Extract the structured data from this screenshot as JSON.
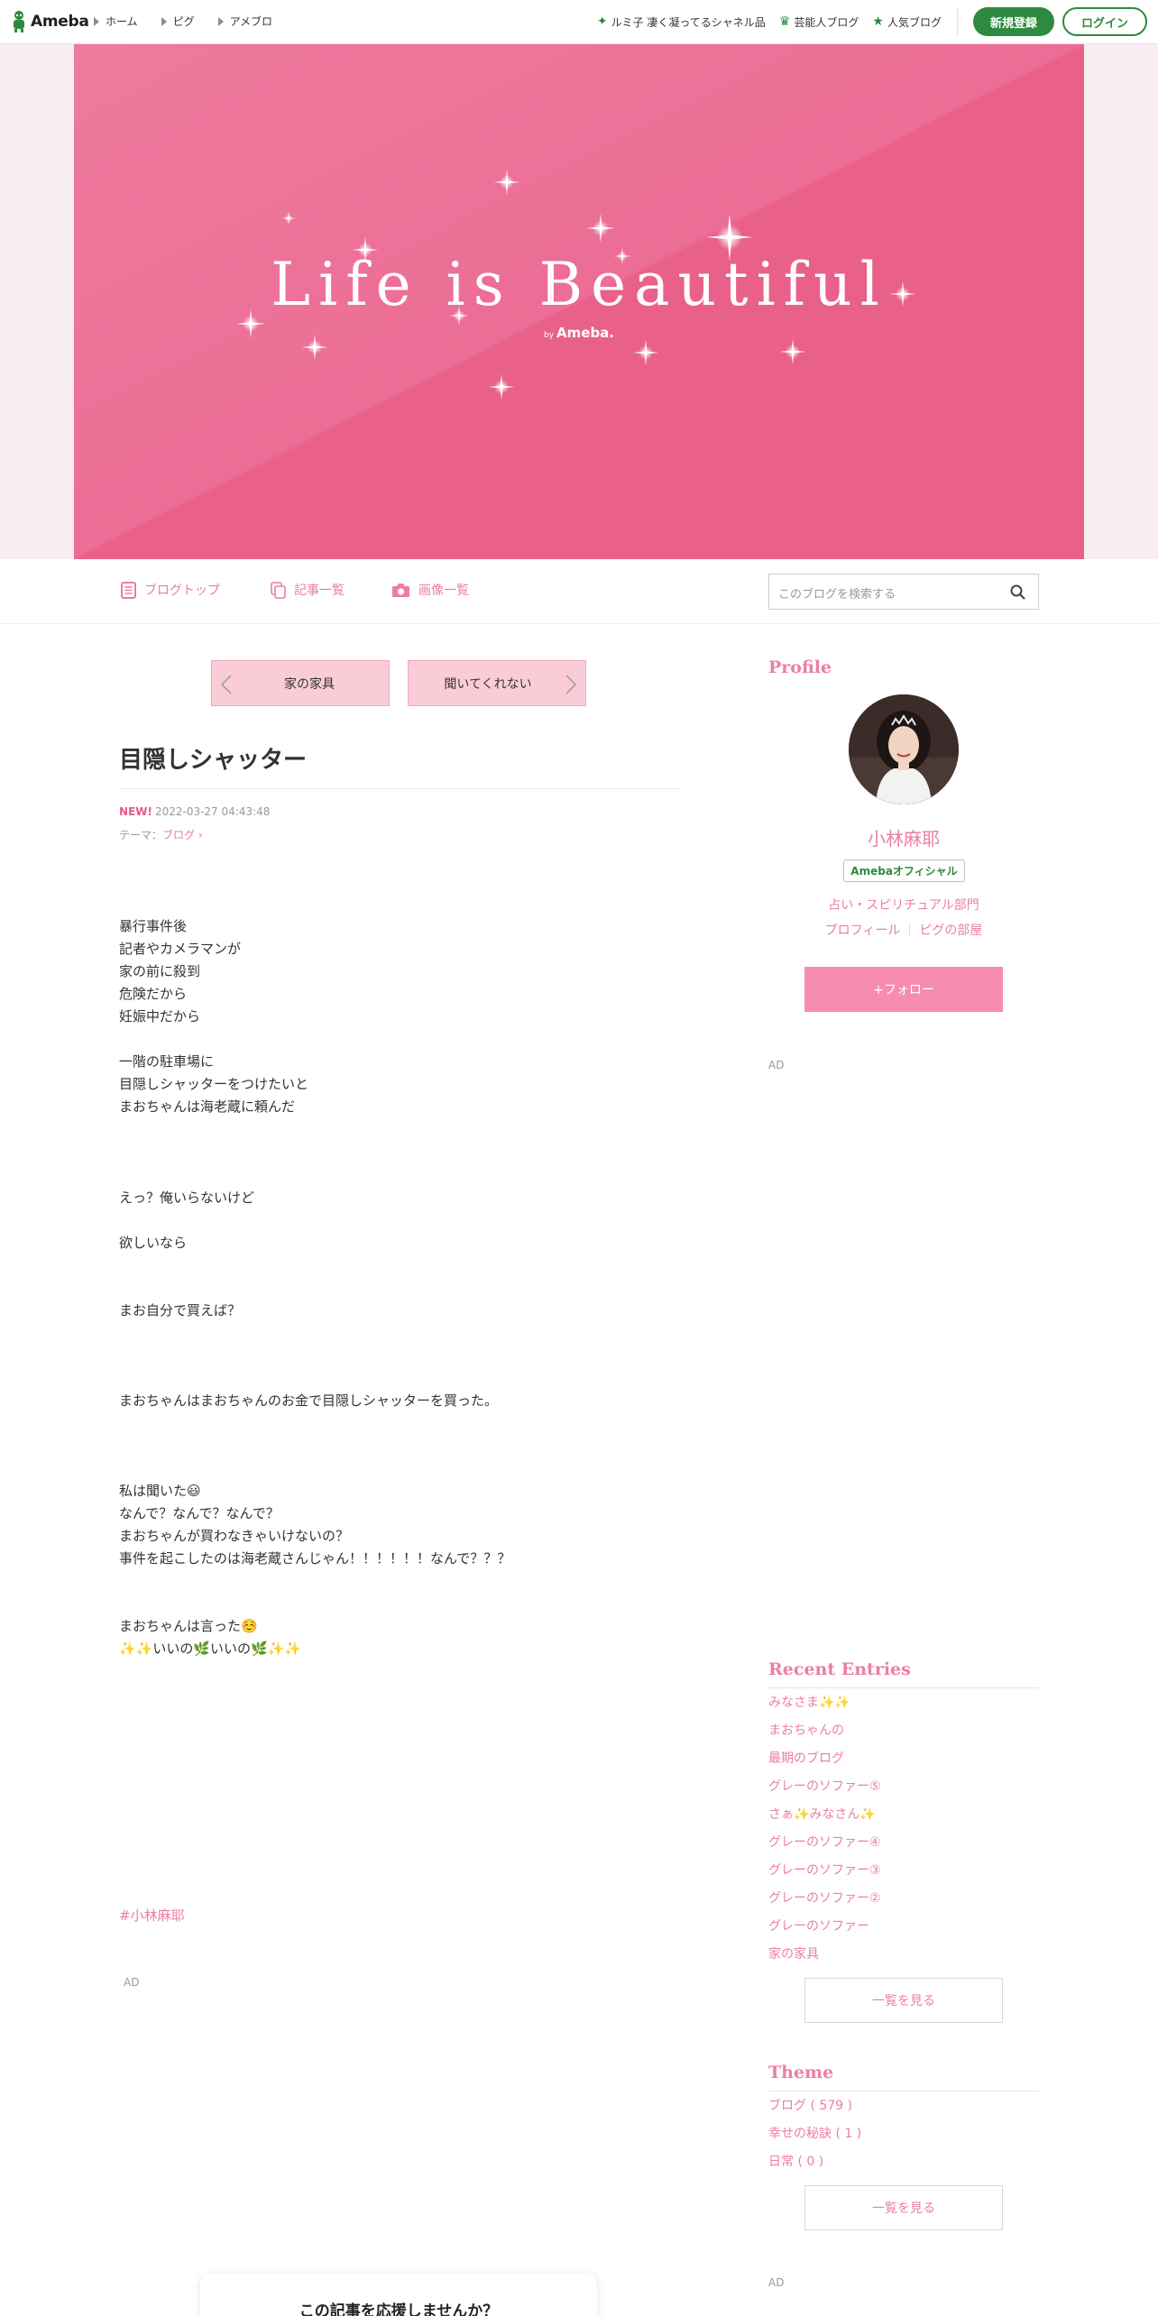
{
  "topbar": {
    "logo_text": "Ameba",
    "nav": [
      "ホーム",
      "ピグ",
      "アメブロ"
    ],
    "right_links": [
      {
        "icon": "sparkle-icon",
        "label": "ルミ子 凄く凝ってるシャネル品"
      },
      {
        "icon": "crown-icon",
        "label": "芸能人ブログ"
      },
      {
        "icon": "star-icon",
        "label": "人気ブログ"
      }
    ],
    "signup_label": "新規登録",
    "login_label": "ログイン"
  },
  "banner": {
    "title": "Life is Beautiful",
    "by": "by",
    "brand": "Ameba."
  },
  "blognav": {
    "items": [
      "ブログトップ",
      "記事一覧",
      "画像一覧"
    ],
    "search_placeholder": "このブログを検索する"
  },
  "article": {
    "prev_label": "家の家具",
    "next_label": "聞いてくれない",
    "title": "目隠しシャッター",
    "new_badge": "NEW!",
    "date": "2022-03-27 04:43:48",
    "theme_prefix": "テーマ：",
    "theme_link": "ブログ",
    "paragraphs": [
      "暴行事件後\n記者やカメラマンが\n家の前に殺到\n危険だから\n妊娠中だから",
      "一階の駐車場に\n目隠しシャッターをつけたいと\nまおちゃんは海老蔵に頼んだ",
      "えっ？俺いらないけど",
      "欲しいなら",
      "まお自分で買えば？",
      "まおちゃんはまおちゃんのお金で目隠しシャッターを買った。",
      "私は聞いた😃\nなんで？なんで？なんで？\nまおちゃんが買わなきゃいけないの？\n事件を起こしたのは海老蔵さんじゃん！！！！！！なんで？？？",
      "まおちゃんは言った☺️\n✨✨いいの🌿いいの🌿✨✨"
    ],
    "hashtag": "#小林麻耶",
    "ad_label": "AD",
    "support_text": "この記事を応援しませんか？"
  },
  "sidebar": {
    "profile_heading": "Profile",
    "name": "小林麻耶",
    "official_badge": "Amebaオフィシャル",
    "category": "占い・スピリチュアル部門",
    "profile_link": "プロフィール",
    "pigg_link": "ピグの部屋",
    "follow_label": "+フォロー",
    "ad_label": "AD",
    "recent_heading": "Recent Entries",
    "recent_entries": [
      "みなさま✨✨",
      "まおちゃんの",
      "最期のブログ",
      "グレーのソファー⑤",
      "さぁ✨みなさん✨",
      "グレーのソファー④",
      "グレーのソファー③",
      "グレーのソファー②",
      "グレーのソファー",
      "家の家具"
    ],
    "see_all_label": "一覧を見る",
    "theme_heading": "Theme",
    "themes": [
      "ブログ ( 579 )",
      "幸せの秘訣 ( 1 )",
      "日常 ( 0 )"
    ],
    "theme_see_all_label": "一覧を見る",
    "ad_label_2": "AD"
  },
  "colors": {
    "accent_pink": "#ec7ea2",
    "banner_pink": "#e9618b",
    "brand_green": "#2d8a3e"
  }
}
